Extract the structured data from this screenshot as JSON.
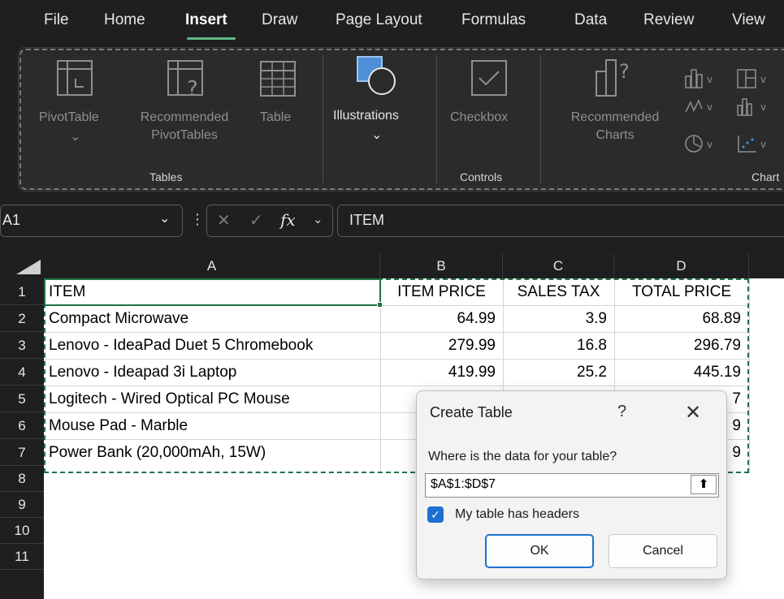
{
  "menu": [
    "File",
    "Home",
    "Insert",
    "Draw",
    "Page Layout",
    "Formulas",
    "Data",
    "Review",
    "View"
  ],
  "ribbon": {
    "pivottable": "PivotTable",
    "recommended_pivot": "Recommended",
    "recommended_pivot2": "PivotTables",
    "table": "Table",
    "illustrations": "Illustrations",
    "checkbox": "Checkbox",
    "recommended_charts": "Recommended",
    "recommended_charts2": "Charts",
    "group_tables": "Tables",
    "group_controls": "Controls",
    "group_charts": "Chart"
  },
  "formula_bar": {
    "name_box": "A1",
    "fx": "fx",
    "value": "ITEM"
  },
  "columns": [
    "A",
    "B",
    "C",
    "D"
  ],
  "rows": [
    "1",
    "2",
    "3",
    "4",
    "5",
    "6",
    "7",
    "8",
    "9",
    "10",
    "11"
  ],
  "table": {
    "headers": [
      "ITEM",
      "ITEM PRICE",
      "SALES TAX",
      "TOTAL PRICE"
    ],
    "data": [
      [
        "Compact Microwave",
        "64.99",
        "3.9",
        "68.89"
      ],
      [
        "Lenovo - IdeaPad Duet 5 Chromebook",
        "279.99",
        "16.8",
        "296.79"
      ],
      [
        "Lenovo - Ideapad 3i Laptop",
        "419.99",
        "25.2",
        "445.19"
      ],
      [
        "Logitech - Wired Optical PC Mouse",
        "",
        "",
        "7"
      ],
      [
        "Mouse Pad - Marble",
        "",
        "",
        "9"
      ],
      [
        "Power Bank (20,000mAh, 15W)",
        "",
        "",
        "9"
      ]
    ]
  },
  "dialog": {
    "title": "Create Table",
    "help": "?",
    "close": "✕",
    "prompt": "Where is the data for your table?",
    "range": "$A$1:$D$7",
    "has_headers_label": "My table has headers",
    "has_headers": true,
    "ok": "OK",
    "cancel": "Cancel"
  },
  "colors": {
    "accent": "#1f6fd1",
    "selection": "#217346",
    "tab_underline": "#62b884"
  }
}
